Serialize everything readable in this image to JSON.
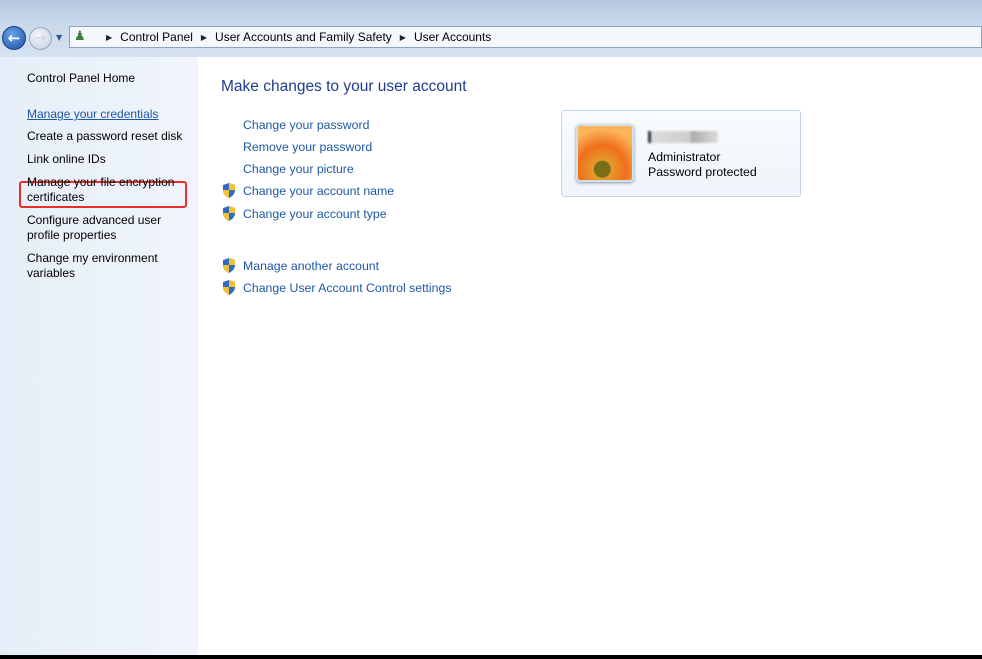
{
  "nav": {
    "back": "back-arrow",
    "forward": "forward-arrow",
    "breadcrumb": [
      "Control Panel",
      "User Accounts and Family Safety",
      "User Accounts"
    ]
  },
  "sidebar": {
    "home": "Control Panel Home",
    "items": [
      "Manage your credentials",
      "Create a password reset disk",
      "Link online IDs",
      "Manage your file encryption certificates",
      "Configure advanced user profile properties",
      "Change my environment variables"
    ],
    "highlighted": "Create a password reset disk",
    "highlight_color": "#e8302a"
  },
  "main": {
    "title": "Make changes to your user account",
    "links": [
      "Change your password",
      "Remove your password",
      "Change your picture",
      "Change your account name",
      "Change your account type"
    ],
    "links2": [
      "Manage another account",
      "Change User Account Control settings"
    ]
  },
  "account": {
    "role": "Administrator",
    "status": "Password protected"
  }
}
